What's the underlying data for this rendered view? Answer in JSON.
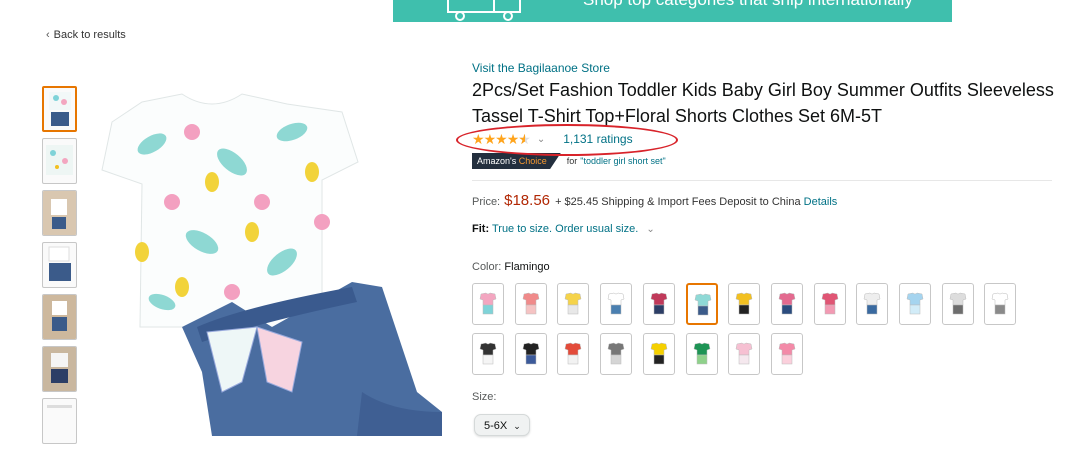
{
  "banner": {
    "text": "Shop top categories that ship internationally"
  },
  "nav": {
    "back_label": "Back to results"
  },
  "product": {
    "store_link": "Visit the Bagilaanoe Store",
    "title": "2Pcs/Set Fashion Toddler Kids Baby Girl Boy Summer Outfits Sleeveless Tassel T-Shirt Top+Floral Shorts Clothes Set 6M-5T",
    "rating_stars": 4.5,
    "ratings_count": "1,131 ratings",
    "badge": {
      "prefix": "Amazon's ",
      "highlight": "Choice",
      "for_label": "for",
      "query": "\"toddler girl short set\""
    },
    "price": {
      "label": "Price:",
      "value": "$18.56",
      "shipping": "+ $25.45 Shipping & Import Fees Deposit to China",
      "details_link": "Details"
    },
    "fit": {
      "label": "Fit:",
      "value": "True to size. Order usual size."
    },
    "color": {
      "label": "Color:",
      "value": "Flamingo",
      "swatches": [
        {
          "c1": "#f3a6c0",
          "c2": "#7fd3d8"
        },
        {
          "c1": "#f08a8a",
          "c2": "#f5c3c3"
        },
        {
          "c1": "#f5d34a",
          "c2": "#e8e8e8"
        },
        {
          "c1": "#ffffff",
          "c2": "#4a7fb0"
        },
        {
          "c1": "#c0395a",
          "c2": "#2c3e66"
        },
        {
          "c1": "#8fd9d6",
          "c2": "#3b5b8a"
        },
        {
          "c1": "#f2c021",
          "c2": "#222222"
        },
        {
          "c1": "#e36a8f",
          "c2": "#2b4c7e"
        },
        {
          "c1": "#e05574",
          "c2": "#f29ab3"
        },
        {
          "c1": "#eeeeee",
          "c2": "#3a6aa0"
        },
        {
          "c1": "#a5d4ef",
          "c2": "#d2ecf8"
        },
        {
          "c1": "#dddddd",
          "c2": "#6d6d6d"
        },
        {
          "c1": "#ffffff",
          "c2": "#8a8a8a"
        },
        {
          "c1": "#333333",
          "c2": "#f5f5f5"
        },
        {
          "c1": "#222222",
          "c2": "#3c5a9a"
        },
        {
          "c1": "#e34b3a",
          "c2": "#f2f2f2"
        },
        {
          "c1": "#777777",
          "c2": "#d5d5d5"
        },
        {
          "c1": "#f5d000",
          "c2": "#222222"
        },
        {
          "c1": "#1e9455",
          "c2": "#8fd18b"
        },
        {
          "c1": "#f6c0d2",
          "c2": "#f5e8ee"
        },
        {
          "c1": "#f38aa8",
          "c2": "#fbd0dc"
        }
      ],
      "selected_index": 5
    },
    "size": {
      "label": "Size:",
      "value": "5-6X"
    }
  },
  "colors": {
    "accent_link": "#007185",
    "price": "#b12704",
    "star": "#ffa41c",
    "selected_border": "#e77600",
    "annotation": "#d8232a"
  }
}
